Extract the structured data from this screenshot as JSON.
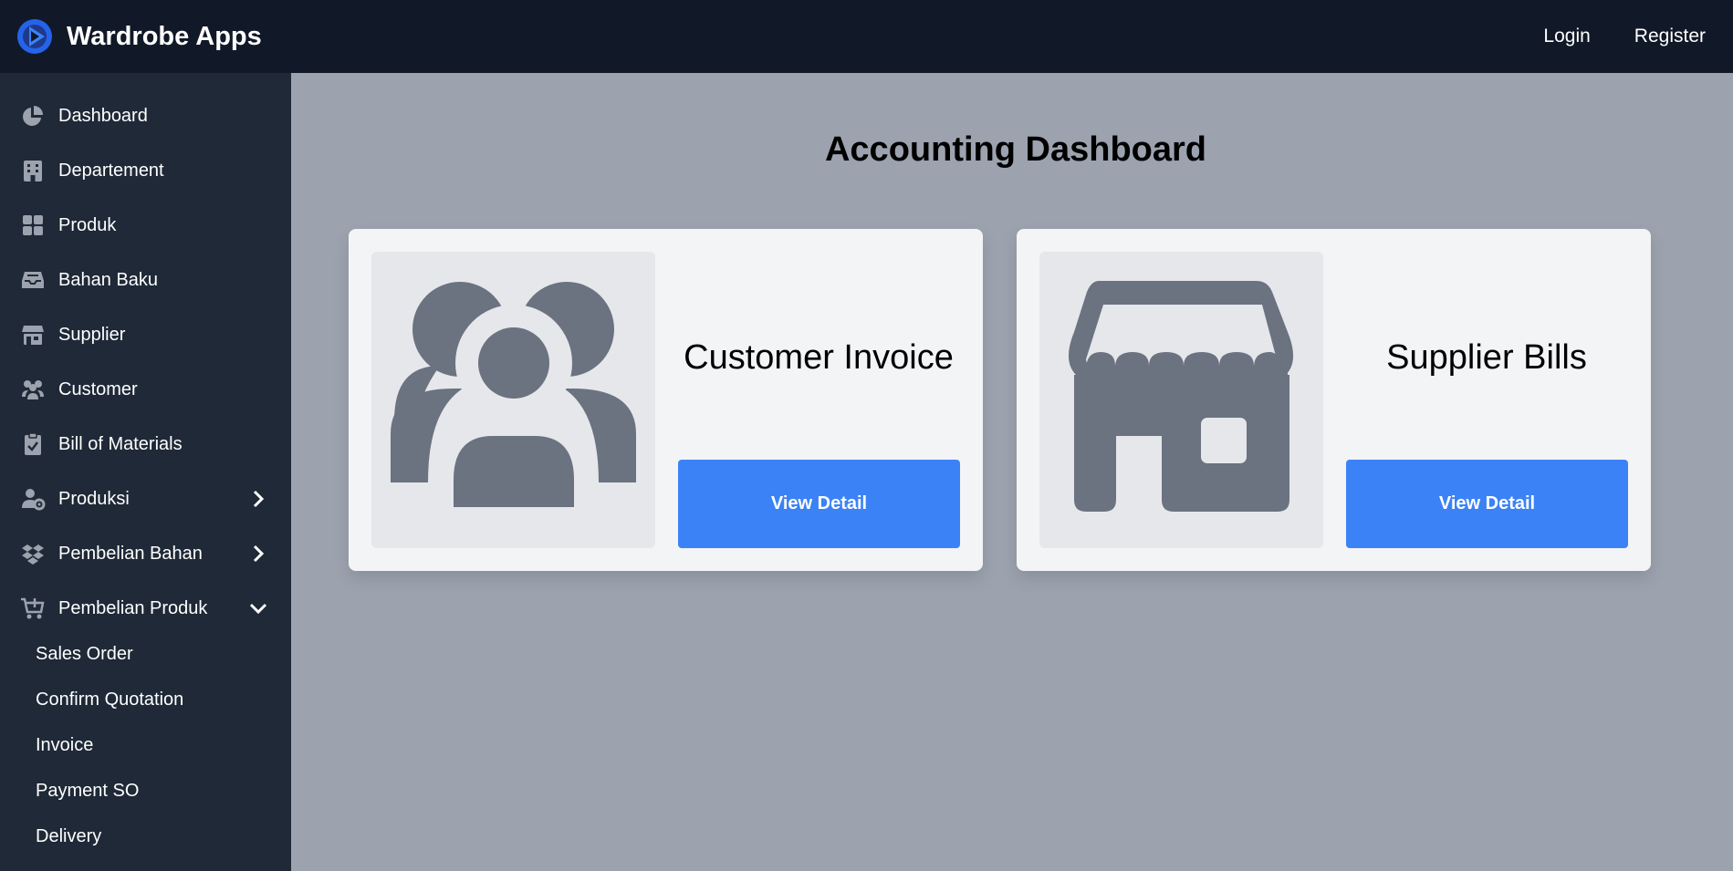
{
  "app": {
    "title": "Wardrobe Apps",
    "logo_icon": "app-logo-icon",
    "brand_color": "#1d4ed8"
  },
  "header": {
    "login_label": "Login",
    "register_label": "Register"
  },
  "sidebar": {
    "items": [
      {
        "label": "Dashboard",
        "icon": "pie-chart-icon"
      },
      {
        "label": "Departement",
        "icon": "building-icon"
      },
      {
        "label": "Produk",
        "icon": "grid-icon"
      },
      {
        "label": "Bahan Baku",
        "icon": "inbox-icon"
      },
      {
        "label": "Supplier",
        "icon": "store-icon"
      },
      {
        "label": "Customer",
        "icon": "users-icon"
      },
      {
        "label": "Bill of Materials",
        "icon": "clipboard-check-icon"
      },
      {
        "label": "Produksi",
        "icon": "user-gear-icon",
        "expanded": false
      },
      {
        "label": "Pembelian Bahan",
        "icon": "dropbox-icon",
        "expanded": false
      },
      {
        "label": "Pembelian Produk",
        "icon": "cart-plus-icon",
        "expanded": true
      }
    ],
    "subitems": [
      {
        "label": "Sales Order"
      },
      {
        "label": "Confirm Quotation"
      },
      {
        "label": "Invoice"
      },
      {
        "label": "Payment SO"
      },
      {
        "label": "Delivery"
      }
    ]
  },
  "main": {
    "title": "Accounting Dashboard",
    "cards": [
      {
        "title": "Customer Invoice",
        "button_label": "View Detail",
        "icon": "users-icon"
      },
      {
        "title": "Supplier Bills",
        "button_label": "View Detail",
        "icon": "store-icon"
      }
    ]
  },
  "colors": {
    "topbar": "#111827",
    "sidebar": "#1f2937",
    "content_bg": "#9ca3af",
    "card_bg": "#f3f4f6",
    "button": "#3b82f6",
    "icon_gray": "#6b7280"
  }
}
